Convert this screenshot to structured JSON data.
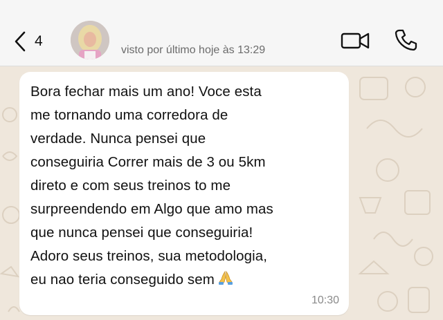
{
  "header": {
    "back_count": "4",
    "status": "visto por último hoje às 13:29",
    "back_icon": "chevron-left-icon",
    "video_icon": "video-camera-icon",
    "phone_icon": "phone-icon"
  },
  "message": {
    "text": "Bora fechar mais um ano! Voce esta\nme tornando uma corredora de\nverdade. Nunca pensei que\nconseguiria Correr mais de 3 ou 5km\ndireto e com seus treinos to me\nsurpreendendo em Algo que amo mas\nque nunca pensei que conseguiria!\nAdoro seus treinos, sua metodologia,\neu nao teria conseguido sem",
    "emoji": "folded-hands-icon",
    "time": "10:30"
  },
  "colors": {
    "chat_background": "#efe7dc",
    "header_background": "#f6f6f6",
    "bubble": "#ffffff"
  }
}
